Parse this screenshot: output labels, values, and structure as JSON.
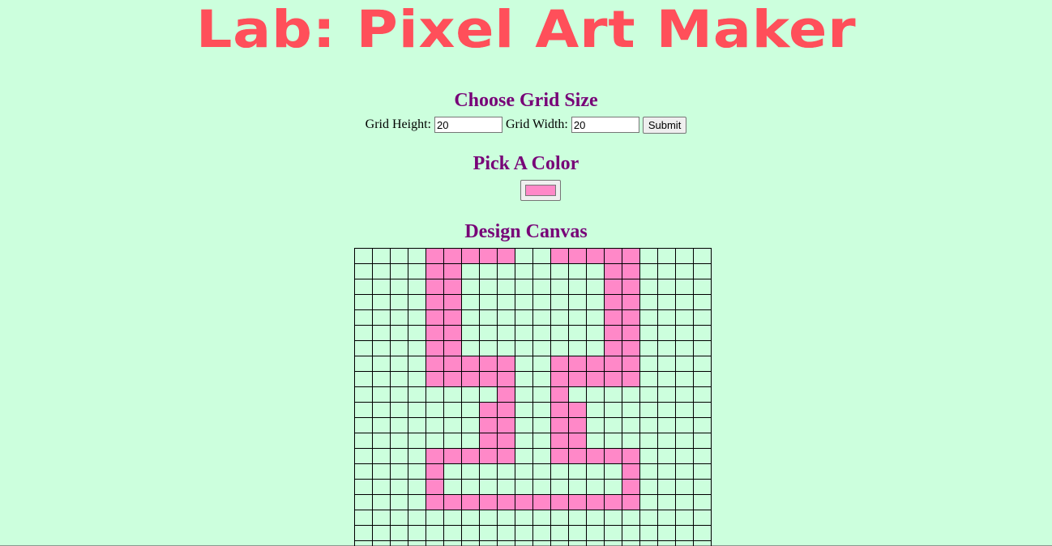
{
  "header": {
    "title": "Lab: Pixel Art Maker"
  },
  "grid_size": {
    "heading": "Choose Grid Size",
    "height_label": "Grid Height:",
    "height_value": "20",
    "width_label": "Grid Width:",
    "width_value": "20",
    "submit_label": "Submit"
  },
  "color": {
    "heading": "Pick A Color",
    "value": "#ff88c8"
  },
  "canvas": {
    "heading": "Design Canvas",
    "rows": 20,
    "cols": 20,
    "painted": [
      [
        0,
        4
      ],
      [
        0,
        5
      ],
      [
        0,
        6
      ],
      [
        0,
        7
      ],
      [
        0,
        8
      ],
      [
        0,
        11
      ],
      [
        0,
        12
      ],
      [
        0,
        13
      ],
      [
        0,
        14
      ],
      [
        0,
        15
      ],
      [
        1,
        4
      ],
      [
        1,
        5
      ],
      [
        1,
        14
      ],
      [
        1,
        15
      ],
      [
        2,
        4
      ],
      [
        2,
        5
      ],
      [
        2,
        14
      ],
      [
        2,
        15
      ],
      [
        3,
        4
      ],
      [
        3,
        5
      ],
      [
        3,
        14
      ],
      [
        3,
        15
      ],
      [
        4,
        4
      ],
      [
        4,
        5
      ],
      [
        4,
        14
      ],
      [
        4,
        15
      ],
      [
        5,
        4
      ],
      [
        5,
        5
      ],
      [
        5,
        14
      ],
      [
        5,
        15
      ],
      [
        6,
        4
      ],
      [
        6,
        5
      ],
      [
        6,
        14
      ],
      [
        6,
        15
      ],
      [
        7,
        4
      ],
      [
        7,
        5
      ],
      [
        7,
        6
      ],
      [
        7,
        7
      ],
      [
        7,
        8
      ],
      [
        7,
        11
      ],
      [
        7,
        12
      ],
      [
        7,
        13
      ],
      [
        7,
        14
      ],
      [
        7,
        15
      ],
      [
        8,
        4
      ],
      [
        8,
        5
      ],
      [
        8,
        6
      ],
      [
        8,
        7
      ],
      [
        8,
        8
      ],
      [
        8,
        11
      ],
      [
        8,
        12
      ],
      [
        8,
        13
      ],
      [
        8,
        14
      ],
      [
        8,
        15
      ],
      [
        9,
        8
      ],
      [
        9,
        11
      ],
      [
        10,
        7
      ],
      [
        10,
        8
      ],
      [
        10,
        11
      ],
      [
        10,
        12
      ],
      [
        11,
        7
      ],
      [
        11,
        8
      ],
      [
        11,
        11
      ],
      [
        11,
        12
      ],
      [
        12,
        7
      ],
      [
        12,
        8
      ],
      [
        12,
        11
      ],
      [
        12,
        12
      ],
      [
        13,
        4
      ],
      [
        13,
        5
      ],
      [
        13,
        6
      ],
      [
        13,
        7
      ],
      [
        13,
        8
      ],
      [
        13,
        11
      ],
      [
        13,
        12
      ],
      [
        13,
        13
      ],
      [
        13,
        14
      ],
      [
        13,
        15
      ],
      [
        14,
        4
      ],
      [
        14,
        15
      ],
      [
        15,
        4
      ],
      [
        15,
        15
      ],
      [
        16,
        4
      ],
      [
        16,
        5
      ],
      [
        16,
        6
      ],
      [
        16,
        7
      ],
      [
        16,
        8
      ],
      [
        16,
        9
      ],
      [
        16,
        10
      ],
      [
        16,
        11
      ],
      [
        16,
        12
      ],
      [
        16,
        13
      ],
      [
        16,
        14
      ],
      [
        16,
        15
      ]
    ]
  }
}
